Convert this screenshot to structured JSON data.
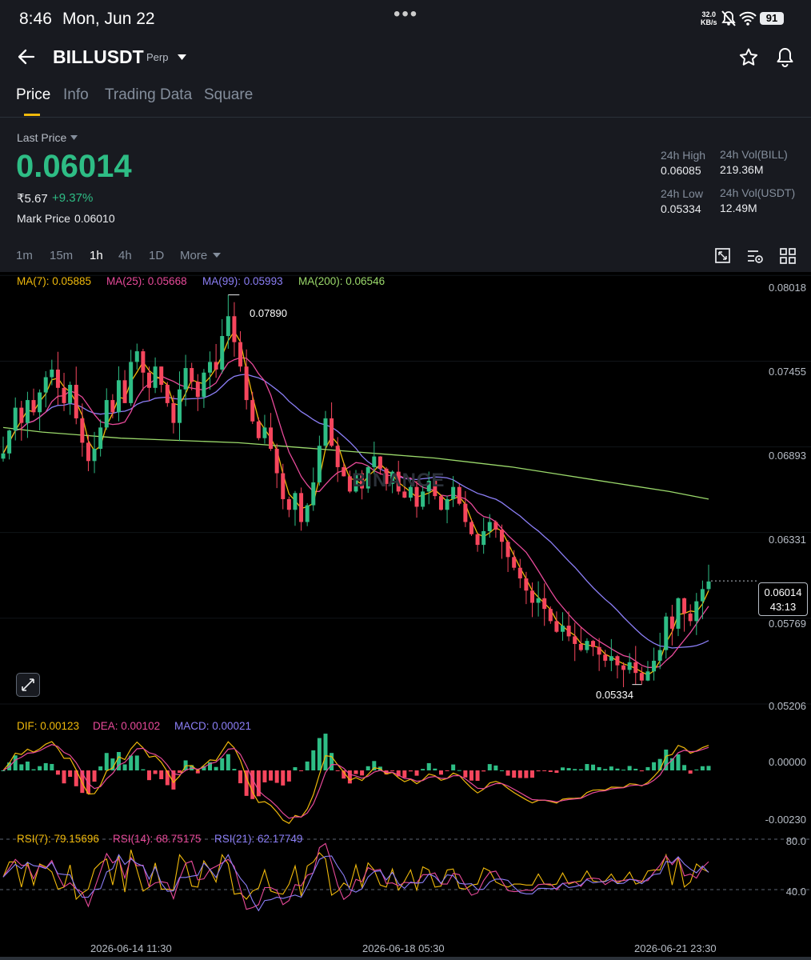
{
  "status_bar": {
    "time": "8:46",
    "date": "Mon, Jun 22",
    "net_speed_value": "32.0",
    "net_speed_unit": "KB/s",
    "battery": "91"
  },
  "header": {
    "symbol": "BILLUSDT",
    "contract_type": "Perp"
  },
  "tabs": [
    {
      "label": "Price",
      "active": true
    },
    {
      "label": "Info",
      "active": false
    },
    {
      "label": "Trading Data",
      "active": false
    },
    {
      "label": "Square",
      "active": false
    }
  ],
  "ticker": {
    "last_price_label": "Last Price",
    "last_price": "0.06014",
    "inr_price": "₹5.67",
    "change_pct": "+9.37%",
    "mark_price_label": "Mark Price",
    "mark_price": "0.06010",
    "high_label": "24h High",
    "high": "0.06085",
    "low_label": "24h Low",
    "low": "0.05334",
    "vol_base_label": "24h Vol(BILL)",
    "vol_base": "219.36M",
    "vol_quote_label": "24h Vol(USDT)",
    "vol_quote": "12.49M"
  },
  "intervals": {
    "items": [
      "1m",
      "15m",
      "1h",
      "4h",
      "1D"
    ],
    "selected": "1h",
    "more_label": "More"
  },
  "colors": {
    "up": "#2ebd85",
    "down": "#f6465d",
    "accent": "#f0b90b",
    "ma7": "#f0b90b",
    "ma25": "#e84a9a",
    "ma99": "#8c7ff7",
    "ma200": "#9bd96b"
  },
  "watermark": "BINANCE",
  "chart_data": [
    {
      "type": "candlestick",
      "series": [
        {
          "name": "MA(7)",
          "value": "0.05885"
        },
        {
          "name": "MA(25)",
          "value": "0.05668"
        },
        {
          "name": "MA(99)",
          "value": "0.05993"
        },
        {
          "name": "MA(200)",
          "value": "0.06546"
        }
      ],
      "y_ticks": [
        "0.08018",
        "0.07455",
        "0.06893",
        "0.06331",
        "0.05769",
        "0.05206"
      ],
      "ylim": [
        0.0518,
        0.0804
      ],
      "annotations": {
        "high": "0.07890",
        "low": "0.05334",
        "current_price": "0.06014",
        "countdown": "43:13"
      },
      "x_ticks": [
        "2026-06-14 11:30",
        "2026-06-18 05:30",
        "2026-06-21 23:30"
      ],
      "approx_closes": [
        0.0685,
        0.07,
        0.0715,
        0.0705,
        0.072,
        0.0712,
        0.0725,
        0.0735,
        0.074,
        0.0728,
        0.0718,
        0.073,
        0.0708,
        0.0692,
        0.068,
        0.0688,
        0.0702,
        0.072,
        0.0712,
        0.0733,
        0.0718,
        0.0745,
        0.0752,
        0.0738,
        0.0728,
        0.0742,
        0.073,
        0.0718,
        0.0705,
        0.0727,
        0.0741,
        0.0732,
        0.0722,
        0.0738,
        0.0745,
        0.074,
        0.0762,
        0.0775,
        0.0758,
        0.0742,
        0.072,
        0.0706,
        0.0695,
        0.0702,
        0.0688,
        0.0672,
        0.0655,
        0.0648,
        0.0659,
        0.064,
        0.0651,
        0.0666,
        0.069,
        0.0708,
        0.069,
        0.0676,
        0.067,
        0.066,
        0.0672,
        0.0662,
        0.0676,
        0.0683,
        0.0675,
        0.0665,
        0.0673,
        0.066,
        0.0656,
        0.0663,
        0.065,
        0.066,
        0.0667,
        0.0657,
        0.0648,
        0.0655,
        0.0663,
        0.0652,
        0.064,
        0.0632,
        0.0625,
        0.0634,
        0.064,
        0.0635,
        0.0627,
        0.0617,
        0.061,
        0.0603,
        0.0595,
        0.0587,
        0.059,
        0.0583,
        0.0575,
        0.0568,
        0.0572,
        0.0565,
        0.056,
        0.0556,
        0.0562,
        0.0558,
        0.0553,
        0.0549,
        0.0552,
        0.0546,
        0.0543,
        0.0548,
        0.0541,
        0.0536,
        0.0542,
        0.0549,
        0.0556,
        0.0578,
        0.057,
        0.059,
        0.058,
        0.0575,
        0.0588,
        0.0596,
        0.0601
      ],
      "approx_ma200": [
        0.0702,
        0.0699,
        0.0697,
        0.0695,
        0.0694,
        0.0693,
        0.0692,
        0.069,
        0.0688,
        0.0686,
        0.0684,
        0.0682,
        0.0679,
        0.0676,
        0.0672,
        0.0668,
        0.0664,
        0.066,
        0.0655
      ]
    },
    {
      "type": "macd",
      "series": [
        {
          "name": "DIF",
          "value": "0.00123"
        },
        {
          "name": "DEA",
          "value": "0.00102"
        },
        {
          "name": "MACD",
          "value": "0.00021"
        }
      ],
      "y_ticks": [
        "0.00000",
        "-0.00230"
      ]
    },
    {
      "type": "rsi",
      "series": [
        {
          "name": "RSI(7)",
          "value": "79.15696"
        },
        {
          "name": "RSI(14)",
          "value": "68.75175"
        },
        {
          "name": "RSI(21)",
          "value": "62.17749"
        }
      ],
      "y_ticks": [
        "80.0",
        "40.0"
      ]
    }
  ]
}
